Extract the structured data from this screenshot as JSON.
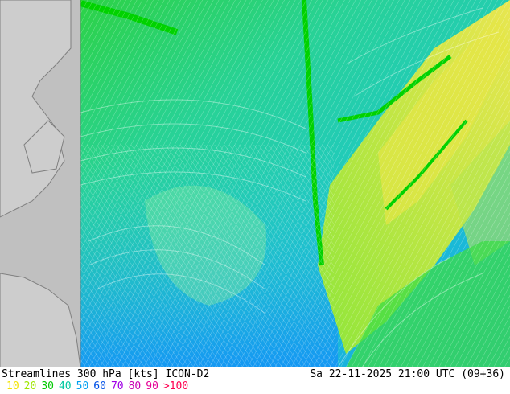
{
  "title": "Streamlines 300 hPa [kts] ICON-D2",
  "datetime": "Sa 22-11-2025 21:00 UTC (09+36)",
  "legend": [
    {
      "label": "10",
      "color": "#f2e400"
    },
    {
      "label": "20",
      "color": "#9ee600"
    },
    {
      "label": "30",
      "color": "#00c800"
    },
    {
      "label": "40",
      "color": "#00c8a0"
    },
    {
      "label": "50",
      "color": "#00a0f0"
    },
    {
      "label": "60",
      "color": "#0050e6"
    },
    {
      "label": "70",
      "color": "#a000e6"
    },
    {
      "label": "80",
      "color": "#c800b4"
    },
    {
      "label": "90",
      "color": "#e60096"
    },
    {
      "label": ">100",
      "color": "#ff0050"
    }
  ],
  "colors": {
    "land": "#cdcdcd",
    "sea": "#c0c0c0",
    "coast": "#808080"
  }
}
